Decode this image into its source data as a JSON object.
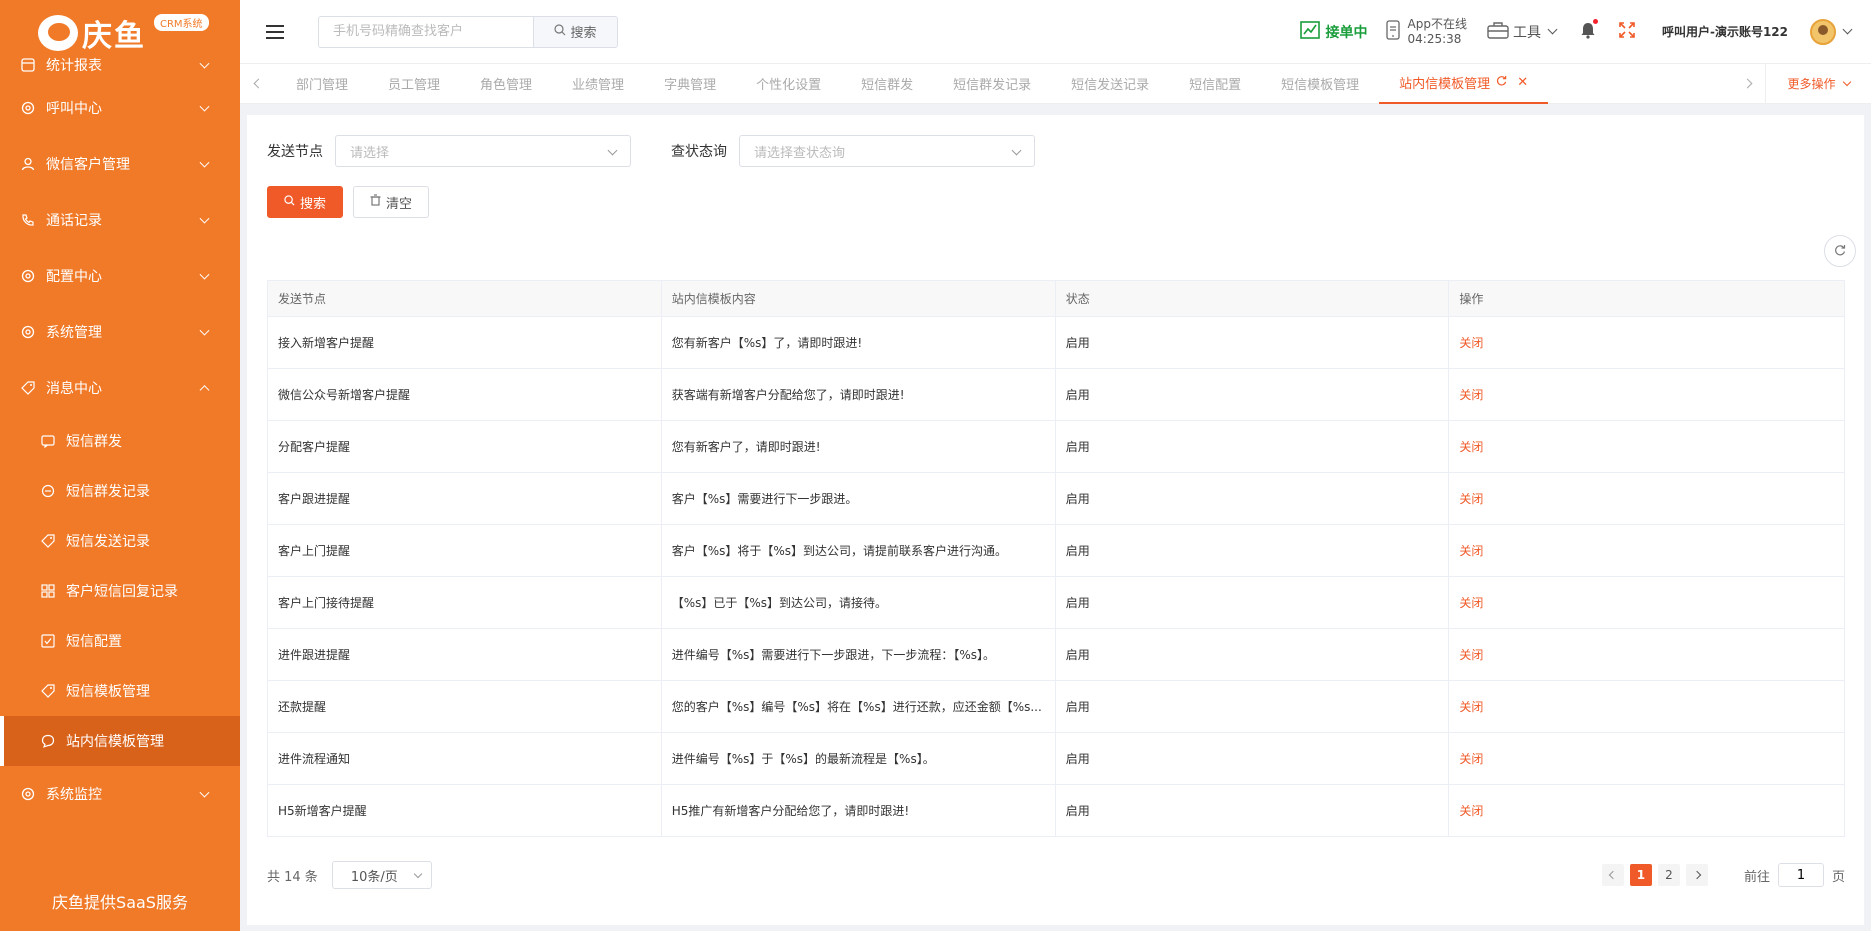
{
  "sidebar": {
    "brand": "庆鱼",
    "badge": "CRM系统",
    "menu": [
      {
        "label": "统计报表"
      },
      {
        "label": "呼叫中心"
      },
      {
        "label": "微信客户管理"
      },
      {
        "label": "通话记录"
      },
      {
        "label": "配置中心"
      },
      {
        "label": "系统管理"
      },
      {
        "label": "消息中心"
      }
    ],
    "submenu": [
      {
        "label": "短信群发"
      },
      {
        "label": "短信群发记录"
      },
      {
        "label": "短信发送记录"
      },
      {
        "label": "客户短信回复记录"
      },
      {
        "label": "短信配置"
      },
      {
        "label": "短信模板管理"
      },
      {
        "label": "站内信模板管理"
      }
    ],
    "after_menu": {
      "label": "系统监控"
    },
    "footer": "庆鱼提供SaaS服务"
  },
  "header": {
    "search_placeholder": "手机号码精确查找客户",
    "search_button": "搜索",
    "status": "接单中",
    "app_status_line1": "App不在线",
    "app_status_line2": "04:25:38",
    "tools": "工具",
    "username": "呼叫用户-演示账号122"
  },
  "tabs": {
    "items": [
      {
        "label": "部门管理"
      },
      {
        "label": "员工管理"
      },
      {
        "label": "角色管理"
      },
      {
        "label": "业绩管理"
      },
      {
        "label": "字典管理"
      },
      {
        "label": "个性化设置"
      },
      {
        "label": "短信群发"
      },
      {
        "label": "短信群发记录"
      },
      {
        "label": "短信发送记录"
      },
      {
        "label": "短信配置"
      },
      {
        "label": "短信模板管理"
      }
    ],
    "active": "站内信模板管理",
    "more": "更多操作"
  },
  "filters": {
    "node_label": "发送节点",
    "node_placeholder": "请选择",
    "status_label": "查状态询",
    "status_placeholder": "请选择查状态询"
  },
  "buttons": {
    "search": "搜索",
    "clear": "清空"
  },
  "table": {
    "headers": [
      "发送节点",
      "站内信模板内容",
      "状态",
      "操作"
    ],
    "rows": [
      [
        "接入新增客户提醒",
        "您有新客户【%s】了，请即时跟进!",
        "启用",
        "关闭"
      ],
      [
        "微信公众号新增客户提醒",
        "获客端有新增客户分配给您了，请即时跟进!",
        "启用",
        "关闭"
      ],
      [
        "分配客户提醒",
        "您有新客户了，请即时跟进!",
        "启用",
        "关闭"
      ],
      [
        "客户跟进提醒",
        "客户【%s】需要进行下一步跟进。",
        "启用",
        "关闭"
      ],
      [
        "客户上门提醒",
        "客户【%s】将于【%s】到达公司，请提前联系客户进行沟通。",
        "启用",
        "关闭"
      ],
      [
        "客户上门接待提醒",
        "【%s】已于【%s】到达公司，请接待。",
        "启用",
        "关闭"
      ],
      [
        "进件跟进提醒",
        "进件编号【%s】需要进行下一步跟进，下一步流程：【%s】。",
        "启用",
        "关闭"
      ],
      [
        "还款提醒",
        "您的客户【%s】编号【%s】将在【%s】进行还款，应还金额【%s...",
        "启用",
        "关闭"
      ],
      [
        "进件流程通知",
        "进件编号【%s】于【%s】的最新流程是【%s】。",
        "启用",
        "关闭"
      ],
      [
        "H5新增客户提醒",
        "H5推广有新增客户分配给您了，请即时跟进!",
        "启用",
        "关闭"
      ]
    ]
  },
  "pager": {
    "total": "共 14 条",
    "page_size": "10条/页",
    "pages": [
      "1",
      "2"
    ],
    "goto_prefix": "前往",
    "goto_value": "1",
    "goto_suffix": "页"
  },
  "colors": {
    "sidebar": "#f07a28",
    "accent": "#f05a28",
    "online": "#1a9d3b"
  }
}
